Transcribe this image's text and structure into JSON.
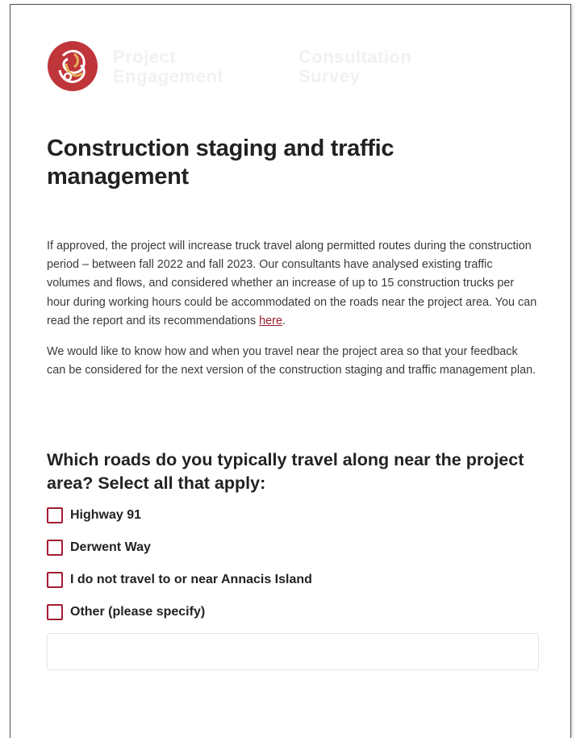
{
  "brand": {
    "logo_line1": "Project",
    "logo_line2": "Engagement",
    "logo_line3": "Consultation",
    "logo_line4": "Survey",
    "colors": {
      "primary": "#a31c30",
      "logo_red": "#c0353a",
      "logo_gold": "#e8b05a"
    }
  },
  "page": {
    "title": "Construction staging and traffic management",
    "intro_paragraph": {
      "text": "If approved, the project will increase truck travel along permitted routes during the construction period – between fall 2022 and fall 2023. Our consultants have analysed existing traffic volumes and flows, and considered whether an increase of up to 15 construction trucks per hour during working hours could be accommodated on the roads near the project area. You can read the report and its recommendations ",
      "link_text": "here",
      "after_link": "."
    },
    "second_paragraph": "We would like to know how and when you travel near the project area so that your feedback can be considered for the next version of the construction staging and traffic management plan."
  },
  "question": {
    "text": "Which roads do you typically travel along near the project area? Select all that apply:",
    "options": [
      {
        "label": "Highway 91",
        "checked": false
      },
      {
        "label": "Derwent Way",
        "checked": false
      },
      {
        "label": "I do not travel to or near Annacis Island",
        "checked": false
      },
      {
        "label": "Other (please specify)",
        "checked": false
      }
    ],
    "other_value": "",
    "other_placeholder": ""
  }
}
